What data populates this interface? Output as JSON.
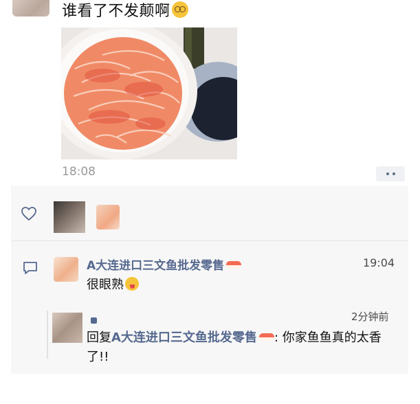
{
  "post": {
    "text": "谁看了不发颠啊",
    "emoji": "dizzy-face-emoji",
    "time": "18:08"
  },
  "likes": {
    "icon": "heart-outline-icon",
    "avatars": [
      "like-avatar-1",
      "like-avatar-2"
    ]
  },
  "comment": {
    "author": "A大连进口三文鱼批发零售",
    "author_emoji": "sushi-emoji",
    "time": "19:04",
    "text": "很眼熟",
    "text_emoji": "tongue-out-emoji"
  },
  "reply": {
    "time": "2分钟前",
    "prefix": "回复",
    "target": "A大连进口三文鱼批发零售",
    "target_emoji": "sushi-emoji",
    "body": ": 你家鱼鱼真的太香了!!"
  },
  "colors": {
    "nickname": "#56698f",
    "panel_bg": "#f7f7f7",
    "timestamp": "#9a9a9a"
  }
}
